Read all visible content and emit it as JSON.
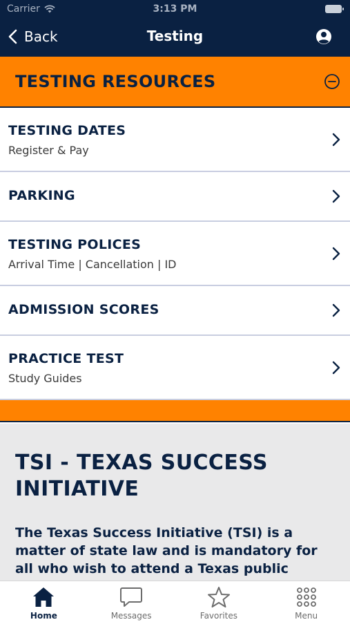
{
  "status_bar": {
    "carrier": "Carrier",
    "time": "3:13 PM"
  },
  "nav": {
    "back_label": "Back",
    "title": "Testing"
  },
  "section": {
    "title": "TESTING RESOURCES"
  },
  "list": {
    "items": [
      {
        "title": "TESTING DATES",
        "subtitle": "Register & Pay"
      },
      {
        "title": "PARKING"
      },
      {
        "title": "TESTING POLICES",
        "subtitle": "Arrival Time | Cancellation | ID"
      },
      {
        "title": "ADMISSION SCORES"
      },
      {
        "title": "PRACTICE TEST",
        "subtitle": "Study Guides"
      }
    ]
  },
  "info": {
    "heading": "TSI - TEXAS SUCCESS INITIATIVE",
    "body": "The Texas Success Initiative (TSI) is a matter of state law and is mandatory for all who wish to attend a Texas public institution. All students enrolling at a Texas public institution must take"
  },
  "tabbar": {
    "tabs": [
      {
        "label": "Home",
        "icon": "home-icon"
      },
      {
        "label": "Messages",
        "icon": "chat-bubble-icon"
      },
      {
        "label": "Favorites",
        "icon": "star-icon"
      },
      {
        "label": "Menu",
        "icon": "grid-dots-icon"
      }
    ]
  },
  "colors": {
    "navy": "#0a2142",
    "orange": "#ff8200",
    "panel_gray": "#e9e9ea"
  }
}
